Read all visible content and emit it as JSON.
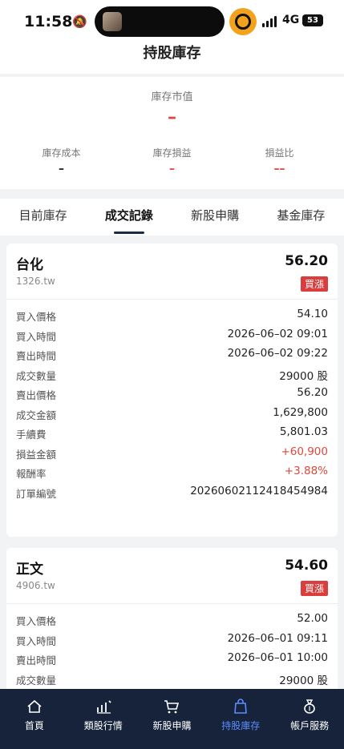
{
  "status_bar": {
    "time": "11:58",
    "network": "4G",
    "battery": "53"
  },
  "header": {
    "title": "持股庫存"
  },
  "market_value": {
    "label": "庫存市值",
    "value": "–",
    "stats": [
      {
        "label": "庫存成本",
        "value": "–",
        "color": "#222222"
      },
      {
        "label": "庫存損益",
        "value": "–",
        "color": "#e0473c"
      },
      {
        "label": "損益比",
        "value": "––",
        "color": "#e0473c"
      }
    ]
  },
  "tabs": [
    {
      "label": "目前庫存",
      "active": false
    },
    {
      "label": "成交記錄",
      "active": true
    },
    {
      "label": "新股申購",
      "active": false
    },
    {
      "label": "基金庫存",
      "active": false
    }
  ],
  "records": [
    {
      "name": "台化",
      "code": "1326.tw",
      "price": "56.20",
      "badge": "買漲",
      "rows": [
        {
          "label": "買入價格",
          "value": "54.10"
        },
        {
          "label": "買入時間",
          "value": "2026–06–02 09:01"
        },
        {
          "label": "賣出時間",
          "value": "2026–06–02 09:22"
        },
        {
          "label": "成交數量",
          "value": "29000 股"
        },
        {
          "label": "賣出價格",
          "value": "56.20"
        },
        {
          "label": "成交金額",
          "value": "1,629,800"
        },
        {
          "label": "手續費",
          "value": "5,801.03"
        },
        {
          "label": "損益金額",
          "value": "+60,900"
        },
        {
          "label": "報酬率",
          "value": "+3.88%"
        },
        {
          "label": "訂單編號",
          "value": "20260602112418454984"
        }
      ]
    },
    {
      "name": "正文",
      "code": "4906.tw",
      "price": "54.60",
      "badge": "買漲",
      "rows": [
        {
          "label": "買入價格",
          "value": "52.00"
        },
        {
          "label": "買入時間",
          "value": "2026–06–01 09:11"
        },
        {
          "label": "賣出時間",
          "value": "2026–06–01 10:00"
        },
        {
          "label": "成交數量",
          "value": "29000 股"
        }
      ]
    }
  ],
  "bottom_nav": [
    {
      "label": "首頁",
      "icon": "home-icon",
      "active": false
    },
    {
      "label": "類股行情",
      "icon": "market-chart-icon",
      "active": false
    },
    {
      "label": "新股申購",
      "icon": "cart-icon",
      "active": false
    },
    {
      "label": "持股庫存",
      "icon": "shopping-bag-icon",
      "active": true
    },
    {
      "label": "帳戶服務",
      "icon": "money-bag-icon",
      "active": false
    }
  ],
  "colors": {
    "nav_bg": "#16233a",
    "nav_active": "#5b8cff",
    "up_red": "#e0473c",
    "badge_red": "#d93d3d"
  }
}
